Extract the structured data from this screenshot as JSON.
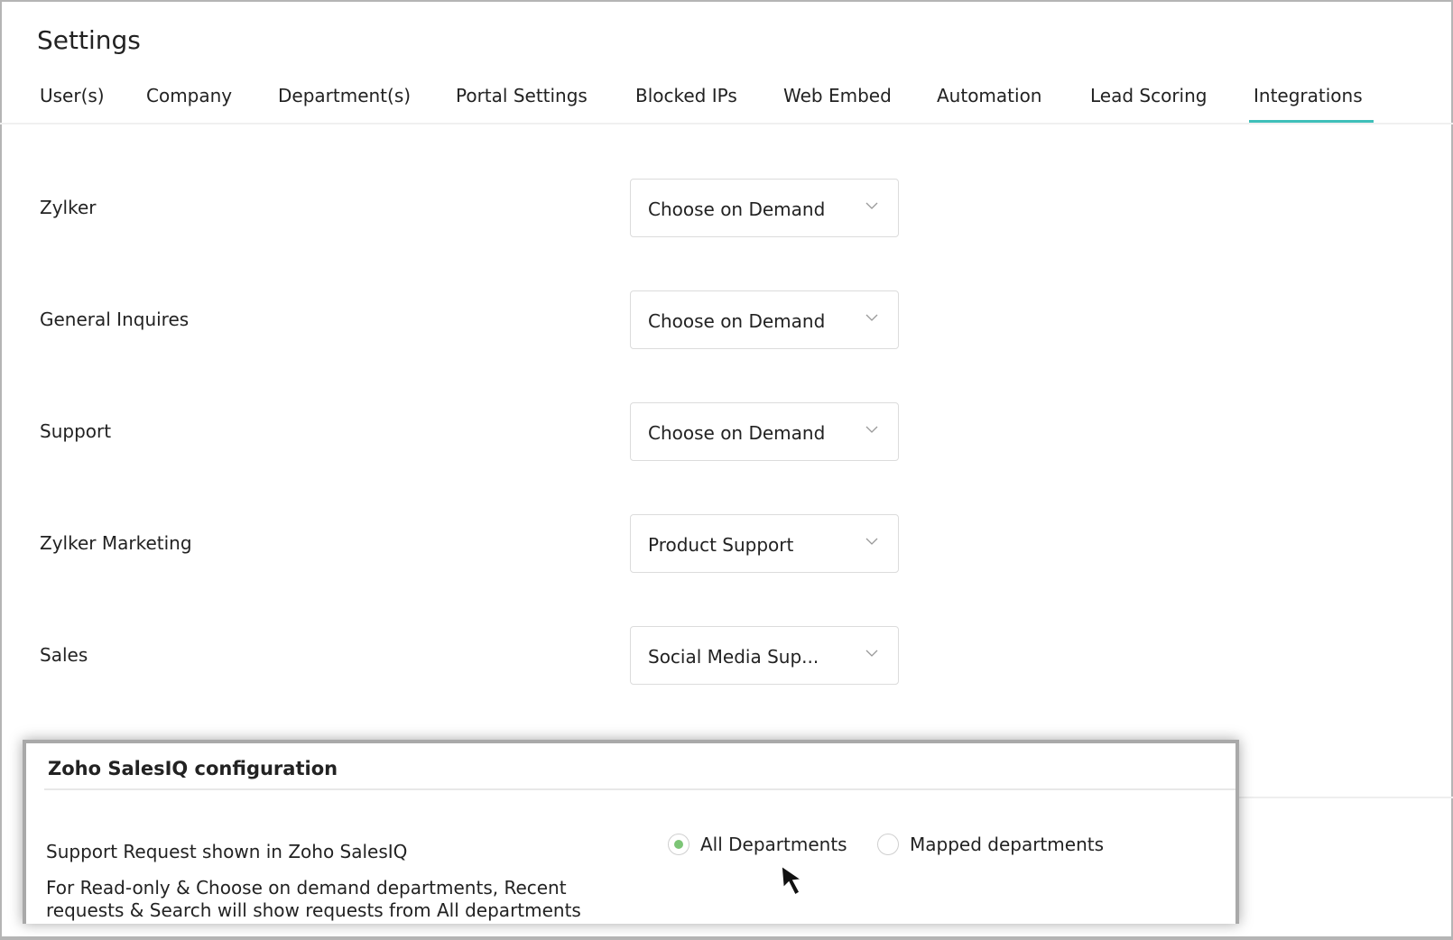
{
  "header": {
    "title": "Settings"
  },
  "tabs": [
    {
      "label": "User(s)"
    },
    {
      "label": "Company"
    },
    {
      "label": "Department(s)"
    },
    {
      "label": "Portal Settings"
    },
    {
      "label": "Blocked IPs"
    },
    {
      "label": "Web Embed"
    },
    {
      "label": "Automation"
    },
    {
      "label": "Lead Scoring"
    },
    {
      "label": "Integrations",
      "active": true
    }
  ],
  "mappings": [
    {
      "department": "Zylker",
      "value": "Choose on Demand"
    },
    {
      "department": "General Inquires",
      "value": "Choose on Demand"
    },
    {
      "department": "Support",
      "value": "Choose on Demand"
    },
    {
      "department": "Zylker Marketing",
      "value": "Product Support"
    },
    {
      "department": "Sales",
      "value": "Social Media Sup..."
    }
  ],
  "salesiq": {
    "title": "Zoho SalesIQ configuration",
    "support_label": "Support Request shown in Zoho SalesIQ",
    "note_line1": "For Read-only & Choose on demand departments, Recent",
    "note_line2": "requests & Search will show requests from All departments",
    "options": [
      {
        "label": "All Departments",
        "selected": true
      },
      {
        "label": "Mapped departments",
        "selected": false
      }
    ]
  },
  "colors": {
    "accent": "#3fbfb9",
    "radio_selected": "#7cc576"
  }
}
